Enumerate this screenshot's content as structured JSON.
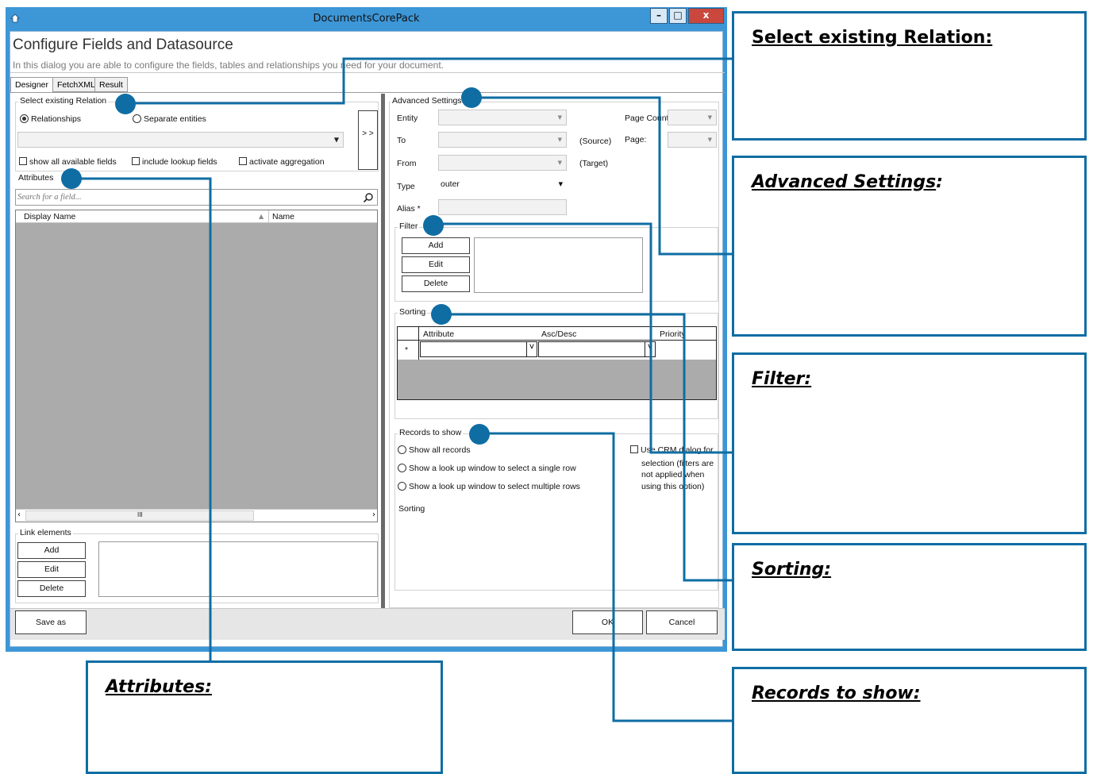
{
  "window": {
    "title": "DocumentsCorePack",
    "buttons": {
      "minimize": "–",
      "maximize": "□",
      "close": "x"
    }
  },
  "header": {
    "title": "Configure Fields and Datasource",
    "subtitle": "In this dialog you are able to configure the fields, tables and relationships you need for your document."
  },
  "tabs": [
    "Designer",
    "FetchXML",
    "Result"
  ],
  "relation": {
    "group_label": "Select existing Relation",
    "radio_relationships": "Relationships",
    "radio_separate": "Separate entities",
    "arrow_button": "> >",
    "chk_show_all": "show all available fields",
    "chk_include_lookup": "include lookup fields",
    "chk_aggregation": "activate aggregation"
  },
  "attributes": {
    "group_label": "Attributes",
    "search_placeholder": "Search for a field...",
    "col_display_name": "Display Name",
    "col_name": "Name",
    "hscroll_thumb": "III"
  },
  "link_elements": {
    "group_label": "Link elements",
    "add": "Add",
    "edit": "Edit",
    "delete": "Delete"
  },
  "advanced": {
    "group_label": "Advanced Settings",
    "entity": "Entity",
    "to": "To",
    "from": "From",
    "type": "Type",
    "type_value": "outer",
    "alias": "Alias *",
    "source": "(Source)",
    "target": "(Target)",
    "page_count": "Page Count",
    "page": "Page:"
  },
  "filter": {
    "group_label": "Filter",
    "add": "Add",
    "edit": "Edit",
    "delete": "Delete"
  },
  "sorting": {
    "group_label": "Sorting",
    "col_attribute": "Attribute",
    "col_ascdesc": "Asc/Desc",
    "col_priority": "Priority",
    "row_marker": "*"
  },
  "records": {
    "group_label": "Records to show",
    "opt_all": "Show all records",
    "opt_single": "Show a look up window to select a single row",
    "opt_multiple": "Show a look up window to select multiple rows",
    "sorting_label": "Sorting",
    "crm_dialog": [
      "Use CRM dialog for",
      "selection (filters are",
      "not applied when",
      "using this option)"
    ]
  },
  "footer": {
    "save_as": "Save as",
    "ok": "OK",
    "cancel": "Cancel"
  },
  "callouts": {
    "select_relation": "Select existing Relation:",
    "advanced": "Advanced Settings",
    "filter": "Filter:",
    "sorting": "Sorting:",
    "records": "Records to show:",
    "attributes": "Attributes:"
  },
  "colors": {
    "accent": "#0f6da3",
    "window_frame": "#3d96d6",
    "list_bg": "#ababab"
  }
}
